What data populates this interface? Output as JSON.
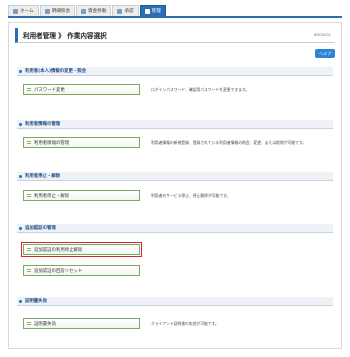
{
  "nav": {
    "tabs": [
      {
        "label": "ホーム",
        "icon": "home-icon"
      },
      {
        "label": "明細照会",
        "icon": "document-icon"
      },
      {
        "label": "資金移動",
        "icon": "transfer-icon"
      },
      {
        "label": "承認",
        "icon": "approve-icon"
      },
      {
        "label": "管理",
        "icon": "settings-icon"
      }
    ],
    "active_tab": "管理"
  },
  "page": {
    "title": "利用者管理 》 作業内容選択",
    "id": "BRGK001",
    "help_label": "ヘルプ"
  },
  "sections": [
    {
      "heading": "利用者(本人)情報の変更・照会",
      "items": [
        {
          "label": "パスワード変更",
          "desc": "ログインパスワード、確認用パスワードを変更できます。"
        }
      ]
    },
    {
      "heading": "利用者情報の管理",
      "items": [
        {
          "label": "利用者情報の管理",
          "desc": "利用者情報の新規登録、登録されている利用者情報の照会、変更、または削除が可能です。"
        }
      ]
    },
    {
      "heading": "利用者停止・解除",
      "items": [
        {
          "label": "利用者停止・解除",
          "desc": "利用者のサービス停止、停止解除が可能です。"
        }
      ]
    },
    {
      "heading": "追加認証の管理",
      "items": [
        {
          "label": "追加認証の利用停止解除",
          "desc": ""
        },
        {
          "label": "追加認証の回答リセット",
          "desc": ""
        }
      ]
    },
    {
      "heading": "証明書失効",
      "items": [
        {
          "label": "証明書失効",
          "desc": "クライアント証明書の失効が可能です。"
        }
      ]
    }
  ],
  "colors": {
    "accent": "#2a6fb5",
    "button_border": "#7ea865",
    "highlight": "#d8262e"
  }
}
